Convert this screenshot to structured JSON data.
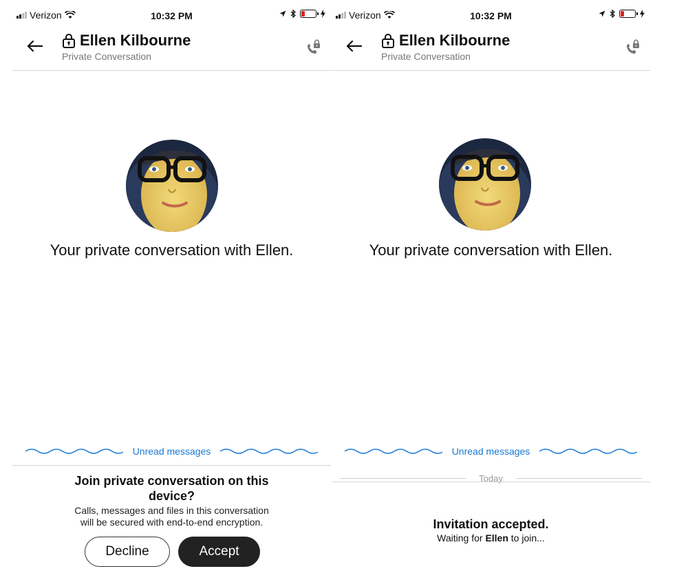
{
  "status": {
    "carrier": "Verizon",
    "time": "10:32 PM"
  },
  "header": {
    "name": "Ellen Kilbourne",
    "subtitle": "Private Conversation"
  },
  "conversation": {
    "headline": "Your private conversation with Ellen."
  },
  "divider": {
    "unread_label": "Unread messages",
    "today_label": "Today"
  },
  "join_prompt": {
    "title_line1": "Join private conversation on this",
    "title_line2": "device?",
    "desc_line1": "Calls, messages and files in this conversation",
    "desc_line2": "will be secured with end-to-end encryption.",
    "decline_label": "Decline",
    "accept_label": "Accept"
  },
  "accepted": {
    "title": "Invitation accepted.",
    "sub_prefix": "Waiting for",
    "sub_name": "Ellen",
    "sub_suffix": "to join..."
  },
  "colors": {
    "accent": "#1a7ad4",
    "battery_low": "#e02020",
    "accept_bg": "#222222"
  }
}
